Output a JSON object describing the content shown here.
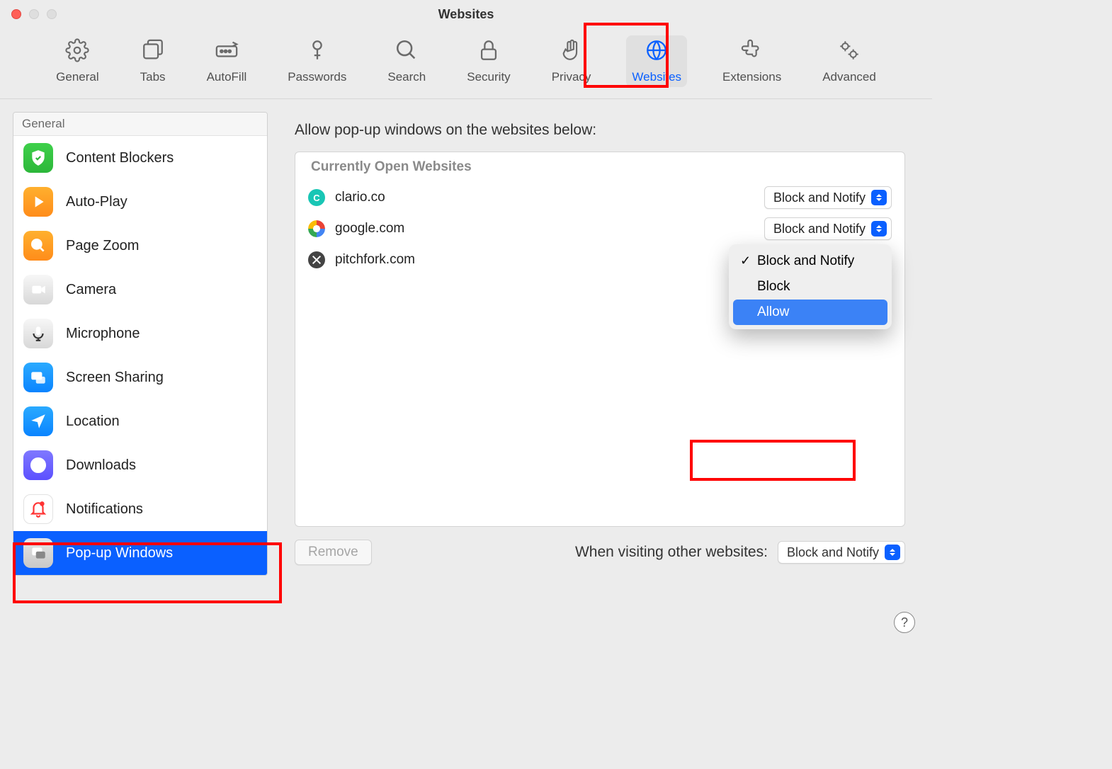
{
  "window": {
    "title": "Websites"
  },
  "toolbar": {
    "items": [
      {
        "label": "General"
      },
      {
        "label": "Tabs"
      },
      {
        "label": "AutoFill"
      },
      {
        "label": "Passwords"
      },
      {
        "label": "Search"
      },
      {
        "label": "Security"
      },
      {
        "label": "Privacy"
      },
      {
        "label": "Websites"
      },
      {
        "label": "Extensions"
      },
      {
        "label": "Advanced"
      }
    ]
  },
  "sidebar": {
    "header": "General",
    "items": [
      {
        "label": "Content Blockers"
      },
      {
        "label": "Auto-Play"
      },
      {
        "label": "Page Zoom"
      },
      {
        "label": "Camera"
      },
      {
        "label": "Microphone"
      },
      {
        "label": "Screen Sharing"
      },
      {
        "label": "Location"
      },
      {
        "label": "Downloads"
      },
      {
        "label": "Notifications"
      },
      {
        "label": "Pop-up Windows"
      }
    ]
  },
  "main": {
    "heading": "Allow pop-up windows on the websites below:",
    "list_header": "Currently Open Websites",
    "sites": [
      {
        "domain": "clario.co",
        "setting": "Block and Notify"
      },
      {
        "domain": "google.com",
        "setting": "Block and Notify"
      },
      {
        "domain": "pitchfork.com",
        "setting": "Block and Notify"
      }
    ],
    "dropdown": {
      "options": [
        {
          "label": "Block and Notify",
          "checked": true
        },
        {
          "label": "Block"
        },
        {
          "label": "Allow",
          "highlighted": true
        }
      ]
    },
    "remove_label": "Remove",
    "other_label": "When visiting other websites:",
    "other_setting": "Block and Notify"
  }
}
